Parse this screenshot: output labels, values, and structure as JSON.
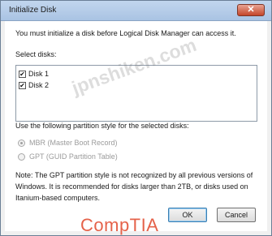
{
  "window": {
    "title": "Initialize Disk",
    "close_glyph": "✕"
  },
  "dialog": {
    "intro": "You must initialize a disk before Logical Disk Manager can access it.",
    "select_label": "Select disks:",
    "disks": [
      {
        "label": "Disk 1",
        "checked": true
      },
      {
        "label": "Disk 2",
        "checked": true
      }
    ],
    "partition_label": "Use the following partition style for the selected disks:",
    "partition_options": [
      {
        "label": "MBR (Master Boot Record)",
        "selected": true,
        "enabled": false
      },
      {
        "label": "GPT (GUID Partition Table)",
        "selected": false,
        "enabled": false
      }
    ],
    "note": "Note: The GPT partition style is not recognized by all previous versions of Windows. It is recommended for disks larger than 2TB, or disks used on Itanium-based computers.",
    "ok_label": "OK",
    "cancel_label": "Cancel"
  },
  "overlay": {
    "watermark": "jpnshiken.com",
    "brand": "CompTIA"
  },
  "icons": {
    "check": "✔"
  },
  "colors": {
    "titlebar": "#b6cde9",
    "close_button": "#c9533a",
    "brand": "#e5624a"
  }
}
